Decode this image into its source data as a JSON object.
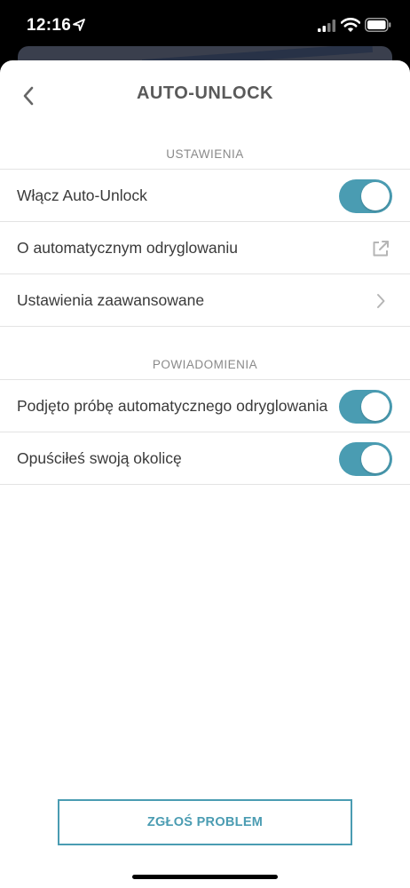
{
  "status_bar": {
    "time": "12:16"
  },
  "header": {
    "title": "AUTO-UNLOCK"
  },
  "sections": {
    "settings": {
      "title": "USTAWIENIA",
      "enable_label": "Włącz Auto-Unlock",
      "about_label": "O automatycznym odryglowaniu",
      "advanced_label": "Ustawienia zaawansowane"
    },
    "notifications": {
      "title": "POWIADOMIENIA",
      "attempt_label": "Podjęto próbę automatycznego odryglowania",
      "left_area_label": "Opuściłeś swoją okolicę"
    }
  },
  "toggles": {
    "enable_auto_unlock": true,
    "attempt_notification": true,
    "left_area_notification": true
  },
  "footer": {
    "report_label": "ZGŁOŚ PROBLEM"
  },
  "colors": {
    "accent": "#4a9cb2",
    "title": "#5a5a5a",
    "section_header": "#8a8a8a",
    "divider": "#e3e3e3"
  },
  "icons": [
    "location-arrow-icon",
    "cellular-signal-icon",
    "wifi-icon",
    "battery-icon",
    "chevron-left-icon",
    "external-link-icon",
    "chevron-right-icon"
  ]
}
